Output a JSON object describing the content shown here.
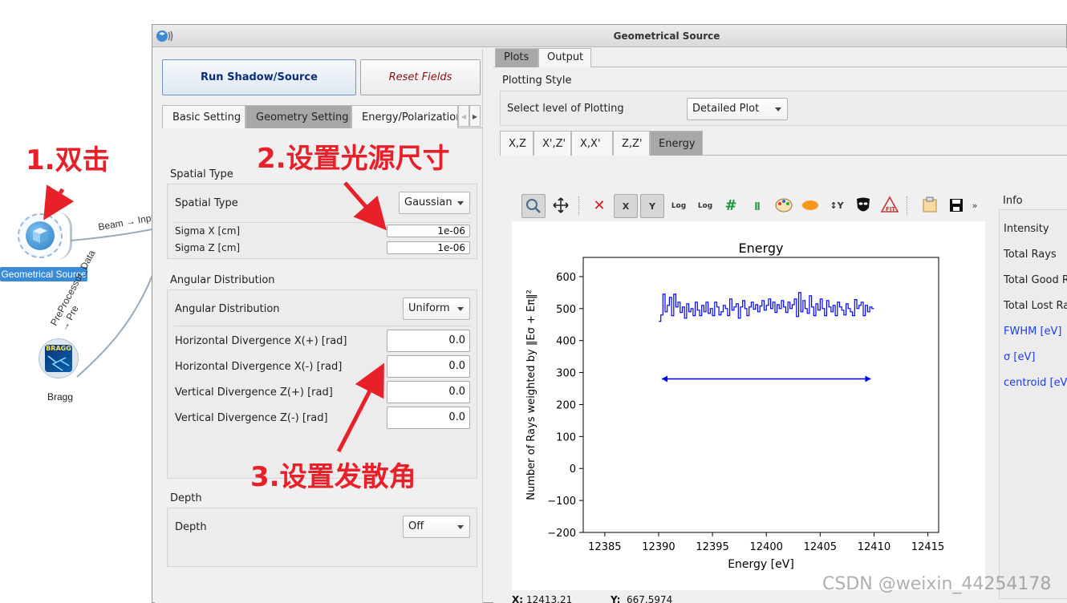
{
  "canvas": {
    "geo_widget_label": "Geometrical Source",
    "bragg_widget_label": "Bragg",
    "bragg_icon_text": "BRAGG",
    "link1_label": "Beam → Inpu",
    "link2_label": "PreProcessor_Data → Pre",
    "annotation1": "1.双击",
    "annotation2": "2.设置光源尺寸",
    "annotation3": "3.设置发散角"
  },
  "window": {
    "title": "Geometrical Source"
  },
  "left": {
    "run_button": "Run Shadow/Source",
    "reset_button": "Reset Fields",
    "tabs": [
      "Basic Setting",
      "Geometry Setting",
      "Energy/Polarization"
    ],
    "spatial": {
      "section": "Spatial Type",
      "type_label": "Spatial Type",
      "type_value": "Gaussian",
      "sigma_x_label": "Sigma X [cm]",
      "sigma_x_value": "1e-06",
      "sigma_z_label": "Sigma Z [cm]",
      "sigma_z_value": "1e-06"
    },
    "angular": {
      "section": "Angular Distribution",
      "type_label": "Angular Distribution",
      "type_value": "Uniform",
      "hdiv_plus_label": "Horizontal Divergence X(+) [rad]",
      "hdiv_plus_value": "0.0",
      "hdiv_minus_label": "Horizontal Divergence X(-) [rad]",
      "hdiv_minus_value": "0.0",
      "vdiv_plus_label": "Vertical Divergence Z(+) [rad]",
      "vdiv_plus_value": "0.0",
      "vdiv_minus_label": "Vertical Divergence Z(-) [rad]",
      "vdiv_minus_value": "0.0"
    },
    "depth": {
      "section": "Depth",
      "label": "Depth",
      "value": "Off"
    }
  },
  "right": {
    "top_tabs": [
      "Plots",
      "Output"
    ],
    "plotting_style_label": "Plotting Style",
    "plot_level_label": "Select level of Plotting",
    "plot_level_value": "Detailed Plot",
    "plot_tabs": [
      "X,Z",
      "X',Z'",
      "X,X'",
      "Z,Z'",
      "Energy"
    ],
    "toolbar_overflow": "»",
    "info": {
      "title": "Info",
      "items": [
        "Intensity",
        "Total Rays",
        "Total Good Ra",
        "Total Lost Ray",
        "FWHM [eV]",
        "σ [eV]",
        "centroid [eV]"
      ]
    },
    "coords": {
      "x_label": "X:",
      "x_value": "12413.21",
      "y_label": "Y:",
      "y_value": "667.5974"
    }
  },
  "watermark": "CSDN @weixin_44254178",
  "chart_data": {
    "type": "line",
    "title": "Energy",
    "xlabel": "Energy [eV]",
    "ylabel": "Number of Rays weighted by ‖Eσ + Eπ‖²",
    "xlim": [
      12383,
      12416
    ],
    "ylim": [
      -200,
      660
    ],
    "xticks": [
      12385,
      12390,
      12395,
      12400,
      12405,
      12410,
      12415
    ],
    "yticks": [
      -200,
      -100,
      0,
      100,
      200,
      300,
      400,
      500,
      600
    ],
    "xtick_labels": [
      "12385",
      "12390",
      "12395",
      "12400",
      "12405",
      "12410",
      "12415"
    ],
    "ytick_labels": [
      "−200",
      "−100",
      "0",
      "100",
      "200",
      "300",
      "400",
      "500",
      "600"
    ],
    "grid": false,
    "colors": {
      "series": "#0000ff"
    },
    "series": [
      {
        "style": "step",
        "x": [
          12390.0,
          12390.2,
          12390.4,
          12390.6,
          12390.8,
          12391.0,
          12391.2,
          12391.4,
          12391.6,
          12391.8,
          12392.0,
          12392.2,
          12392.4,
          12392.6,
          12392.8,
          12393.0,
          12393.2,
          12393.4,
          12393.6,
          12393.8,
          12394.0,
          12394.2,
          12394.4,
          12394.6,
          12394.8,
          12395.0,
          12395.2,
          12395.4,
          12395.6,
          12395.8,
          12396.0,
          12396.2,
          12396.4,
          12396.6,
          12396.8,
          12397.0,
          12397.2,
          12397.4,
          12397.6,
          12397.8,
          12398.0,
          12398.2,
          12398.4,
          12398.6,
          12398.8,
          12399.0,
          12399.2,
          12399.4,
          12399.6,
          12399.8,
          12400.0,
          12400.2,
          12400.4,
          12400.6,
          12400.8,
          12401.0,
          12401.2,
          12401.4,
          12401.6,
          12401.8,
          12402.0,
          12402.2,
          12402.4,
          12402.6,
          12402.8,
          12403.0,
          12403.2,
          12403.4,
          12403.6,
          12403.8,
          12404.0,
          12404.2,
          12404.4,
          12404.6,
          12404.8,
          12405.0,
          12405.2,
          12405.4,
          12405.6,
          12405.8,
          12406.0,
          12406.2,
          12406.4,
          12406.6,
          12406.8,
          12407.0,
          12407.2,
          12407.4,
          12407.6,
          12407.8,
          12408.0,
          12408.2,
          12408.4,
          12408.6,
          12408.8,
          12409.0,
          12409.2,
          12409.4,
          12409.6,
          12409.8
        ],
        "y": [
          460,
          480,
          545,
          490,
          510,
          535,
          478,
          545,
          505,
          520,
          488,
          505,
          470,
          515,
          490,
          500,
          478,
          520,
          495,
          478,
          510,
          490,
          520,
          485,
          500,
          478,
          520,
          505,
          480,
          490,
          510,
          500,
          478,
          530,
          495,
          505,
          515,
          470,
          505,
          525,
          500,
          478,
          505,
          520,
          498,
          512,
          490,
          508,
          525,
          495,
          510,
          530,
          500,
          520,
          488,
          512,
          500,
          525,
          505,
          488,
          520,
          500,
          512,
          530,
          475,
          550,
          490,
          525,
          500,
          485,
          540,
          505,
          478,
          515,
          495,
          530,
          500,
          478,
          525,
          505,
          490,
          510,
          478,
          520,
          505,
          495,
          480,
          515,
          500,
          490,
          478,
          528,
          500,
          510,
          520,
          478,
          510,
          490,
          505,
          500
        ]
      }
    ],
    "annotations": [
      {
        "type": "double-arrow",
        "x_from": 12390.3,
        "x_to": 12409.7,
        "y": 280
      }
    ]
  }
}
